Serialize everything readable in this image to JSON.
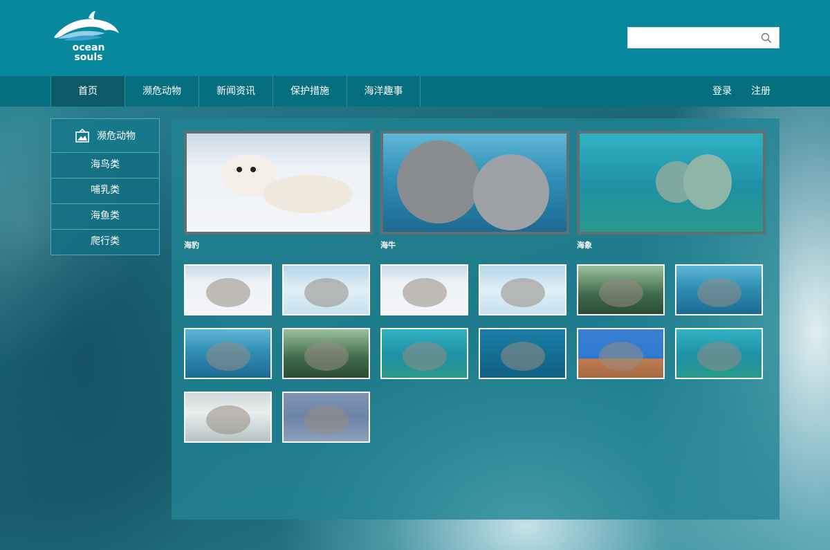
{
  "brand": {
    "line1": "ocean",
    "line2": "souls"
  },
  "search": {
    "placeholder": "",
    "value": ""
  },
  "nav": {
    "items": [
      "首页",
      "濒危动物",
      "新闻资讯",
      "保护措施",
      "海洋趣事"
    ],
    "active": "首页",
    "login": "登录",
    "register": "注册"
  },
  "sidebar": {
    "header": "濒危动物",
    "items": [
      "海鸟类",
      "哺乳类",
      "海鱼类",
      "爬行类"
    ]
  },
  "featured": [
    {
      "label": "海豹",
      "scene": "snow"
    },
    {
      "label": "海牛",
      "scene": "water"
    },
    {
      "label": "海象",
      "scene": "water2"
    }
  ],
  "thumbnails": [
    {
      "scene": "snow"
    },
    {
      "scene": "ice"
    },
    {
      "scene": "snow"
    },
    {
      "scene": "ice"
    },
    {
      "scene": "green"
    },
    {
      "scene": "water"
    },
    {
      "scene": "water"
    },
    {
      "scene": "green"
    },
    {
      "scene": "water2"
    },
    {
      "scene": "deep"
    },
    {
      "scene": "sunny"
    },
    {
      "scene": "water2"
    },
    {
      "scene": "zoo"
    },
    {
      "scene": "gray"
    }
  ],
  "colors": {
    "header": "#08889c",
    "nav": "#056f80",
    "nav_active": "#0c5a68",
    "panel": "#20848f"
  }
}
